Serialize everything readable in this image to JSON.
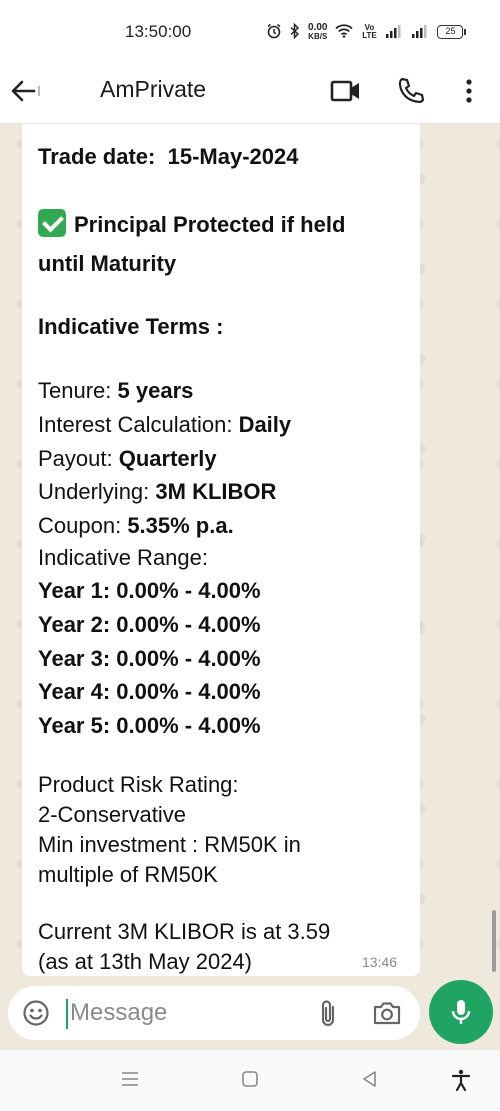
{
  "status_bar": {
    "time": "13:50:00",
    "net_speed_value": "0.00",
    "net_speed_unit": "KB/S",
    "volte_label": "Vo LTE",
    "battery_level": "25"
  },
  "header": {
    "title": "AmPrivate"
  },
  "message": {
    "line1_label": "Trade date:",
    "line1_value": "15-May-2024",
    "principal_line1": "Principal Protected if held",
    "principal_line2": "until Maturity",
    "indicative_terms": "Indicative Terms :",
    "tenure_label": "Tenure:",
    "tenure_value": "5 years",
    "interest_label": "Interest Calculation:",
    "interest_value": "Daily",
    "payout_label": "Payout:",
    "payout_value": "Quarterly",
    "underlying_label": "Underlying:",
    "underlying_value": "3M KLIBOR",
    "coupon_label": "Coupon:",
    "coupon_value": "5.35% p.a.",
    "range_label": "Indicative Range:",
    "years": [
      "Year 1: 0.00% - 4.00%",
      "Year 2: 0.00% - 4.00%",
      "Year 3: 0.00% - 4.00%",
      "Year 4: 0.00% - 4.00%",
      "Year 5: 0.00% - 4.00%"
    ],
    "risk_line1": "Product Risk Rating:",
    "risk_line2": "2-Conservative",
    "min_line1": "Min investment : RM50K in",
    "min_line2": "multiple of RM50K",
    "klibor_line1": "Current 3M KLIBOR is at 3.59",
    "klibor_line2": "(as at 13th May 2024)",
    "timestamp": "13:46"
  },
  "composer": {
    "placeholder": "Message"
  },
  "colors": {
    "accent_green": "#1fa463",
    "chat_background": "#efe8dd"
  }
}
